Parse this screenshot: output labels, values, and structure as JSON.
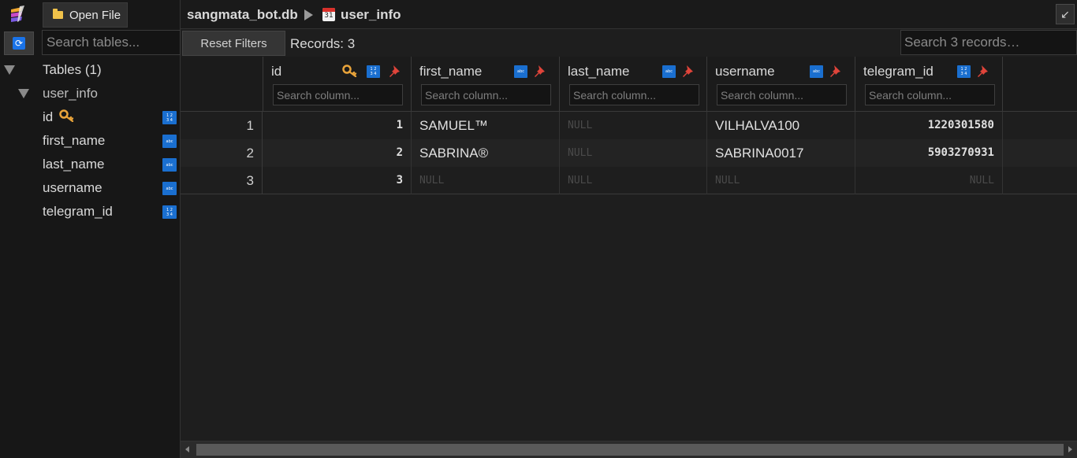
{
  "app": {
    "open_file_label": "Open File",
    "search_tables_placeholder": "Search tables..."
  },
  "breadcrumb": {
    "database": "sangmata_bot.db",
    "table": "user_info",
    "calendar_day": "31"
  },
  "sidebar": {
    "tables_header": "Tables (1)",
    "table_name": "user_info",
    "columns": [
      {
        "name": "id",
        "type": "integer",
        "primary_key": true
      },
      {
        "name": "first_name",
        "type": "text",
        "primary_key": false
      },
      {
        "name": "last_name",
        "type": "text",
        "primary_key": false
      },
      {
        "name": "username",
        "type": "text",
        "primary_key": false
      },
      {
        "name": "telegram_id",
        "type": "integer",
        "primary_key": false
      }
    ]
  },
  "toolbar": {
    "reset_filters_label": "Reset Filters",
    "records_label": "Records: 3",
    "search_records_placeholder": "Search 3 records…",
    "expand_icon": "↙"
  },
  "grid": {
    "column_search_placeholder": "Search column...",
    "headers": [
      "id",
      "first_name",
      "last_name",
      "username",
      "telegram_id"
    ],
    "rows": [
      {
        "rownum": "1",
        "id": "1",
        "first_name": "SAMUEL™",
        "last_name": "NULL",
        "username": "VILHALVA100",
        "telegram_id": "1220301580"
      },
      {
        "rownum": "2",
        "id": "2",
        "first_name": "SABRINA®",
        "last_name": "NULL",
        "username": "SABRINA0017",
        "telegram_id": "5903270931"
      },
      {
        "rownum": "3",
        "id": "3",
        "first_name": "NULL",
        "last_name": "NULL",
        "username": "NULL",
        "telegram_id": "NULL"
      }
    ]
  },
  "icons": {
    "integer_badge": "1 2 3 4",
    "text_badge": "abc"
  },
  "colors": {
    "background": "#1e1e1e",
    "sidebar": "#171717",
    "badge_blue": "#1a6fd0",
    "pin_red": "#e0443a",
    "key_gold": "#e8a33a",
    "null_text": "#4a4a4a"
  }
}
